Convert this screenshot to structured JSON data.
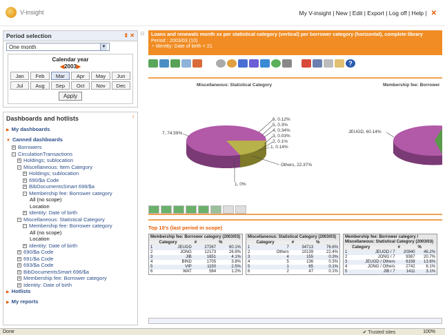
{
  "app": {
    "logo_text": "V-insight"
  },
  "topnav": {
    "text": "My V-insight | New | Edit | Export | Log off | Help |"
  },
  "period": {
    "title": "Period selection",
    "select_value": "One month",
    "cal_title": "Calendar year",
    "year": "2003",
    "months": [
      "Jan",
      "Feb",
      "Mar",
      "Apr",
      "May",
      "Jun",
      "Jul",
      "Aug",
      "Sep",
      "Oct",
      "Nov",
      "Dec"
    ],
    "selected_month": "Mar",
    "apply": "Apply"
  },
  "dash": {
    "title": "Dashboards and hotlists",
    "items": {
      "my_dash": "My dashboards",
      "canned": "Canned dashboards",
      "borrowers": "Borrowers",
      "circ": "CirculationTransactions",
      "holdings1": "Holdings; sublocation",
      "misc_item": "Miscellaneous: Item Category",
      "holdings2": "Holdings; sublocation",
      "code690": "690/$a Code",
      "bib1": "BibDocumentsSmart 696/$a",
      "membership1": "Membership fee: Borrower category",
      "allscope1": "All (no scope)",
      "location1": "Location",
      "identity1": "Identity: Date of birth",
      "misc_stat": "Miscellaneous: Statistical Category",
      "membership2": "Membership fee: Borrower category",
      "allscope2": "All (no scope)",
      "location2": "Location",
      "identity2": "Identity: Date of birth",
      "code690b": "690/$a Code",
      "code691": "691/$a Code",
      "code693": "693/$a Code",
      "bib2": "BibDocumentsSmart 696/$a",
      "membership3": "Membership fee: Borrower category",
      "identity3": "Identity: Date of birth",
      "hotlists": "Hotlists",
      "reports": "My reports"
    }
  },
  "main": {
    "header": "Loans and renewals month xx per statistical category (vertical) per borrower category (horizontal), complete library",
    "period": "Period : 2003/03 (10)",
    "filter": "Identity: Date of birth < 21",
    "top10": "Top 10's (last period in scope)"
  },
  "chart_data": [
    {
      "type": "pie",
      "title": "Miscellaneous: Statistical Category",
      "slices": [
        {
          "label": "7",
          "value": 74.59
        },
        {
          "label": "Others",
          "value": 22.37
        },
        {
          "label": "6",
          "value": 0.12
        },
        {
          "label": "5",
          "value": 0.3
        },
        {
          "label": "4",
          "value": 0.34
        },
        {
          "label": "3",
          "value": 0.03
        },
        {
          "label": "2",
          "value": 0.1
        },
        {
          "label": "1",
          "value": 0.14
        },
        {
          "label": "1",
          "value": 0
        }
      ],
      "labels_text": [
        "7, 74.59%",
        "Others, 22.37%",
        "6, 0.12%",
        "5, 0.3%",
        "4, 0.34%",
        "3, 0.03%",
        "2, 0.1%",
        "1, 0.14%",
        "1, 0%"
      ],
      "colors": {
        "main": "#b259a8",
        "others": "#b8b24a"
      }
    },
    {
      "type": "pie",
      "title": "Membership fee: Borrower",
      "slices": [
        {
          "label": "JEUGD",
          "value": 60.14
        }
      ],
      "labels_text": [
        "JEUGD, 60.14%"
      ]
    }
  ],
  "tables": [
    {
      "title": "Membership fee: Borrower category (2003/03)",
      "headers": [
        "Category",
        "#",
        "%"
      ],
      "rows": [
        [
          "1",
          "JEUGD",
          "27267",
          "60.1%"
        ],
        [
          "2",
          "JONG",
          "12173",
          "26.9%"
        ],
        [
          "3",
          "JIB",
          "1651",
          "4.1%"
        ],
        [
          "4",
          "BIND",
          "1705",
          "3.8%"
        ],
        [
          "5",
          "VIP",
          "1150",
          "2.5%"
        ],
        [
          "6",
          "WAT",
          "584",
          "1.2%"
        ]
      ]
    },
    {
      "title": "Miscellaneous: Statistical Category (2003/03)",
      "headers": [
        "Category",
        "#",
        "%"
      ],
      "rows": [
        [
          "1",
          "7",
          "34713",
          "76.6%"
        ],
        [
          "2",
          "Others",
          "10139",
          "22.4%"
        ],
        [
          "3",
          "4",
          "155",
          "0.3%"
        ],
        [
          "4",
          "5",
          "136",
          "0.3%"
        ],
        [
          "5",
          "1",
          "65",
          "0.1%"
        ],
        [
          "6",
          "2",
          "47",
          "0.1%"
        ]
      ]
    },
    {
      "title": "Membership fee: Borrower category / Miscellaneous: Statistical Category (2003/03)",
      "headers": [
        "Category",
        "#",
        "%"
      ],
      "rows": [
        [
          "1",
          "JEUGD / 7",
          "20940",
          "46.2%"
        ],
        [
          "2",
          "JONG / 7",
          "9387",
          "20.7%"
        ],
        [
          "3",
          "JEUGD / Others",
          "6158",
          "13.6%"
        ],
        [
          "4",
          "JONG / Others",
          "2742",
          "6.1%"
        ],
        [
          "5",
          "JIB / 7",
          "1411",
          "3.1%"
        ]
      ]
    }
  ],
  "status": {
    "left": "Done",
    "trust": "Trusted sites",
    "zoom": "100%"
  }
}
